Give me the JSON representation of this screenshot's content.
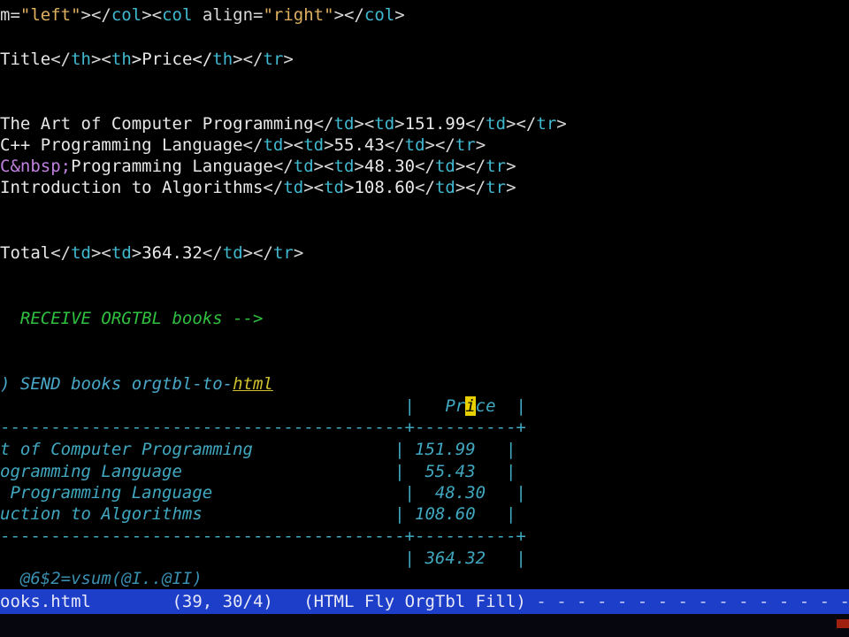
{
  "code_lines": {
    "l1": {
      "p1": "m=",
      "p2": "\"left\"",
      "p3": "></",
      "p4": "col",
      "p5": "><",
      "p6": "col ",
      "p7": "align=",
      "p8": "\"right\"",
      "p9": "></",
      "p10": "col"
    },
    "l2": {
      "p1": "Title",
      "p2": "</",
      "p3": "th",
      "p4": "><",
      "p5": "th",
      "p6": ">Price</",
      "p7": "th",
      "p8": "></",
      "p9": "tr",
      "p10": ">"
    },
    "l3": {
      "text": "The Art of Computer Programming",
      "num": "151.99"
    },
    "l4": {
      "text": "C++ Programming Language",
      "num": "55.43"
    },
    "l5": {
      "amp": "C&nbsp;",
      "text": "Programming Language",
      "num": "48.30"
    },
    "l6": {
      "text": "Introduction to Algorithms",
      "num": "108.60"
    },
    "l7": {
      "text": "Total",
      "num": "364.32"
    },
    "comment": "RECEIVE ORGTBL books -->",
    "send_prefix": ") ",
    "send_kw": "SEND books orgtbl-to-",
    "send_link": "html"
  },
  "tags": {
    "td": "td",
    "tr": "tr"
  },
  "org_table": {
    "header_pre": "Pr",
    "header_cursor": "i",
    "header_post": "ce",
    "rows": [
      {
        "title": "t of Computer Programming",
        "price": "151.99"
      },
      {
        "title": "ogramming Language",
        "price": "55.43"
      },
      {
        "title": " Programming Language",
        "price": "48.30"
      },
      {
        "title": "uction to Algorithms",
        "price": "108.60"
      }
    ],
    "total": "364.32"
  },
  "formula": "@6$2=vsum(@I..@II)",
  "modeline": {
    "buffer": "ooks.html",
    "position": "(39, 30/4)",
    "modes": "(HTML Fly OrgTbl Fill)"
  }
}
